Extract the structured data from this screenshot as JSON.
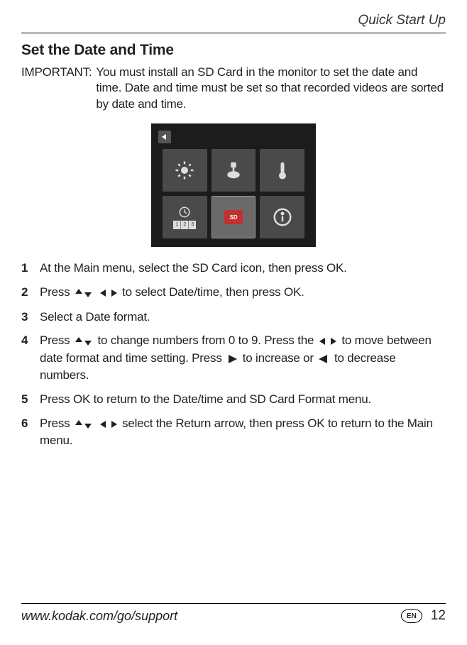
{
  "header": {
    "breadcrumb": "Quick Start Up"
  },
  "section_title": "Set the Date and Time",
  "important": {
    "label": "IMPORTANT:",
    "text": "You must install an SD Card in the monitor to set the date and time. Date and time must be set so that recorded videos are sorted by date and time."
  },
  "screenshot": {
    "sd_label": "SD",
    "date_digits": [
      "1",
      "2",
      "3"
    ]
  },
  "steps": {
    "s1": "At the Main menu, select the SD Card icon, then press OK.",
    "s2a": "Press ",
    "s2b": " to select Date/time, then press OK.",
    "s3": "Select a Date format.",
    "s4a": "Press ",
    "s4b": " to change numbers from 0 to 9. Press the ",
    "s4c": " to move between date format and time setting. Press ",
    "s4d": " to increase or ",
    "s4e": " to decrease numbers.",
    "s5": "Press OK to return to the Date/time and SD Card Format menu.",
    "s6a": "Press ",
    "s6b": " select the Return arrow, then press OK to return to the Main menu."
  },
  "footer": {
    "link": "www.kodak.com/go/support",
    "lang": "EN",
    "page": "12"
  }
}
